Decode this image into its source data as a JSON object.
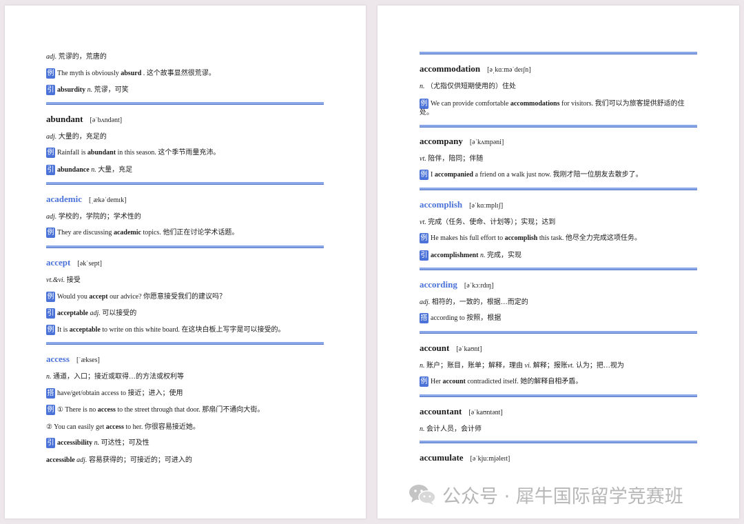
{
  "left": {
    "absurd_def_pos": "adj.",
    "absurd_def": " 荒谬的，荒唐的",
    "absurd_ex_pre": "The myth is obviously ",
    "absurd_ex_bold": "absurd",
    "absurd_ex_post": " . 这个故事显然很荒谬。",
    "absurd_der_bold": "absurdity",
    "absurd_der_pos": " n.",
    "absurd_der_def": " 荒谬，可笑",
    "abundant_word": "abundant",
    "abundant_phon": "[əˈbʌndənt]",
    "abundant_pos": "adj.",
    "abundant_def": " 大量的，充足的",
    "abundant_ex_pre": "Rainfall is ",
    "abundant_ex_bold": "abundant",
    "abundant_ex_post": " in this season. 这个季节雨量充沛。",
    "abundant_der_bold": "abundance",
    "abundant_der_pos": " n.",
    "abundant_der_def": " 大量，充足",
    "academic_word": "academic",
    "academic_phon": "[ˌækəˈdemɪk]",
    "academic_pos": "adj.",
    "academic_def": " 学校的，学院的；学术性的",
    "academic_ex_pre": "They are discussing ",
    "academic_ex_bold": "academic",
    "academic_ex_post": " topics. 他们正在讨论学术话题。",
    "accept_word": "accept",
    "accept_phon": "[əkˈsept]",
    "accept_pos": "vt.&vi.",
    "accept_def": " 接受",
    "accept_ex1_pre": "Would you ",
    "accept_ex1_bold": "accept",
    "accept_ex1_post": " our advice? 你愿意接受我们的建议吗？",
    "accept_der_bold": "acceptable",
    "accept_der_pos": " adj.",
    "accept_der_def": " 可以接受的",
    "accept_ex2_pre": "It is ",
    "accept_ex2_bold": "acceptable",
    "accept_ex2_post": " to write on this white board. 在这块白板上写字是可以接受的。",
    "access_word": "access",
    "access_phon": "[ˈækses]",
    "access_pos": "n.",
    "access_def": " 通道，入口；接近或取得…的方法或权利等",
    "access_colloc": "have/get/obtain access to 接近；进入；使用",
    "access_ex1_pre": "① There is no ",
    "access_ex1_bold": "access",
    "access_ex1_post": " to the street through that door. 那扇门不通向大街。",
    "access_ex2_pre": "② You can easily get ",
    "access_ex2_bold": "access",
    "access_ex2_post": " to her. 你很容易接近她。",
    "access_der_bold": "accessibility",
    "access_der_pos": " n.",
    "access_der_def": " 可达性；可及性",
    "access_der2_bold": "accessible",
    "access_der2_pos": " adj.",
    "access_der2_def": " 容易获得的；可接近的；可进入的"
  },
  "right": {
    "accommodation_word": "accommodation",
    "accommodation_phon": "[əˌkɑːməˈdeɪʃn]",
    "accommodation_pos": "n.",
    "accommodation_def": " （尤指仅供短期使用的）住处",
    "accommodation_ex_pre": "We can provide comfortable ",
    "accommodation_ex_bold": "accommodations",
    "accommodation_ex_post": " for visitors. 我们可以为旅客提供舒适的住处。",
    "accompany_word": "accompany",
    "accompany_phon": "[əˈkʌmpəni]",
    "accompany_pos": "vt.",
    "accompany_def": " 陪伴，陪同；伴随",
    "accompany_ex_pre": "I ",
    "accompany_ex_bold": "accompanied",
    "accompany_ex_post": " a friend on a walk just now. 我刚才陪一位朋友去散步了。",
    "accomplish_word": "accomplish",
    "accomplish_phon": "[əˈkɑːmplɪʃ]",
    "accomplish_pos": "vt.",
    "accomplish_def": " 完成（任务、使命、计划等）；实现；达到",
    "accomplish_ex_pre": "He makes his full effort to ",
    "accomplish_ex_bold": "accomplish",
    "accomplish_ex_post": " this task. 他尽全力完成这项任务。",
    "accomplish_der_bold": "accomplishment",
    "accomplish_der_pos": " n.",
    "accomplish_der_def": " 完成，实现",
    "according_word": "according",
    "according_phon": "[əˈkɔːrdɪŋ]",
    "according_pos": "adj.",
    "according_def": " 相符的，一致的，根据…而定的",
    "according_colloc": "according to 按照，根据",
    "account_word": "account",
    "account_phon": "[əˈkaʊnt]",
    "account_pos": "n.",
    "account_def_a": " 账户；账目，账单；解释，理由 ",
    "account_pos2": "vi.",
    "account_def_b": " 解释；报账",
    "account_pos3": "vt.",
    "account_def_c": " 认为；把…视为",
    "account_ex_pre": "Her ",
    "account_ex_bold": "account",
    "account_ex_post": " contradicted itself. 她的解释自相矛盾。",
    "accountant_word": "accountant",
    "accountant_phon": "[əˈkaʊntənt]",
    "accountant_pos": "n.",
    "accountant_def": " 会计人员，会计师",
    "accumulate_word": "accumulate",
    "accumulate_phon": "[əˈkjuːmjəleɪt]"
  },
  "tags": {
    "example": "例",
    "derivative": "引",
    "collocation": "搭"
  },
  "watermark": {
    "text": "公众号 · 犀牛国际留学竞赛班",
    "icon": "wechat-icon"
  }
}
